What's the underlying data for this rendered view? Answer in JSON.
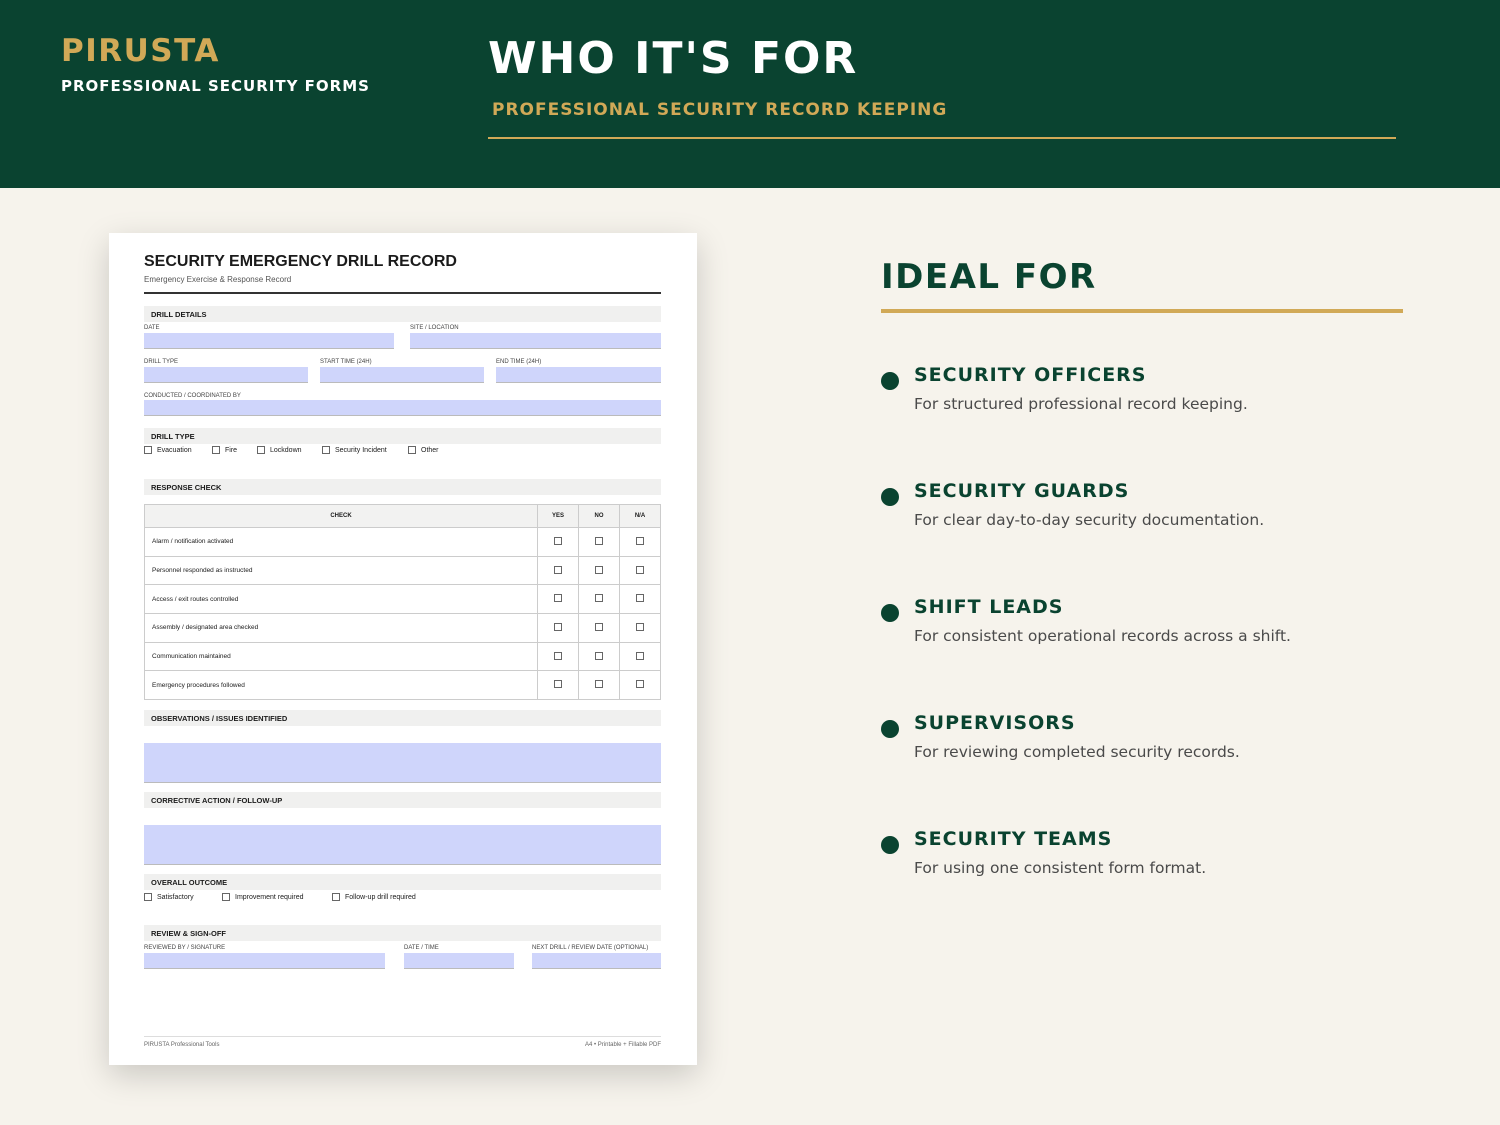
{
  "header": {
    "brand": "PIRUSTA",
    "brand_sub": "PROFESSIONAL SECURITY FORMS",
    "title": "WHO IT'S FOR",
    "subtitle": "PROFESSIONAL SECURITY RECORD KEEPING"
  },
  "document": {
    "title": "SECURITY EMERGENCY DRILL RECORD",
    "subtitle": "Emergency Exercise & Response Record",
    "drill_details": {
      "heading": "DRILL DETAILS",
      "date_label": "DATE",
      "site_label": "SITE / LOCATION",
      "type_label": "DRILL TYPE",
      "start_label": "START TIME (24H)",
      "end_label": "END TIME (24H)",
      "conducted_label": "CONDUCTED / COORDINATED BY"
    },
    "drill_type": {
      "heading": "DRILL TYPE",
      "options": [
        "Evacuation",
        "Fire",
        "Lockdown",
        "Security Incident",
        "Other"
      ]
    },
    "response_check": {
      "heading": "RESPONSE CHECK",
      "columns": [
        "CHECK",
        "YES",
        "NO",
        "N/A"
      ],
      "rows": [
        "Alarm / notification activated",
        "Personnel responded as instructed",
        "Access / exit routes controlled",
        "Assembly / designated area checked",
        "Communication maintained",
        "Emergency procedures followed"
      ]
    },
    "observations_heading": "OBSERVATIONS / ISSUES IDENTIFIED",
    "corrective_heading": "CORRECTIVE ACTION / FOLLOW-UP",
    "outcome": {
      "heading": "OVERALL OUTCOME",
      "options": [
        "Satisfactory",
        "Improvement required",
        "Follow-up drill required"
      ]
    },
    "signoff": {
      "heading": "REVIEW & SIGN-OFF",
      "reviewed_label": "REVIEWED BY / SIGNATURE",
      "datetime_label": "DATE / TIME",
      "next_label": "NEXT DRILL / REVIEW DATE (OPTIONAL)"
    },
    "footer_left": "PIRUSTA Professional Tools",
    "footer_right": "A4 • Printable + Fillable PDF"
  },
  "ideal": {
    "title": "IDEAL FOR",
    "items": [
      {
        "title": "SECURITY OFFICERS",
        "desc": "For structured professional record keeping."
      },
      {
        "title": "SECURITY GUARDS",
        "desc": "For clear day-to-day security documentation."
      },
      {
        "title": "SHIFT LEADS",
        "desc": "For consistent operational records across a shift."
      },
      {
        "title": "SUPERVISORS",
        "desc": "For reviewing completed security records."
      },
      {
        "title": "SECURITY TEAMS",
        "desc": "For using one consistent form format."
      }
    ]
  },
  "colors": {
    "header_green": "#0a4330",
    "gold": "#d1a957",
    "background": "#f6f3ec",
    "field_fill": "#cfd5fb"
  }
}
